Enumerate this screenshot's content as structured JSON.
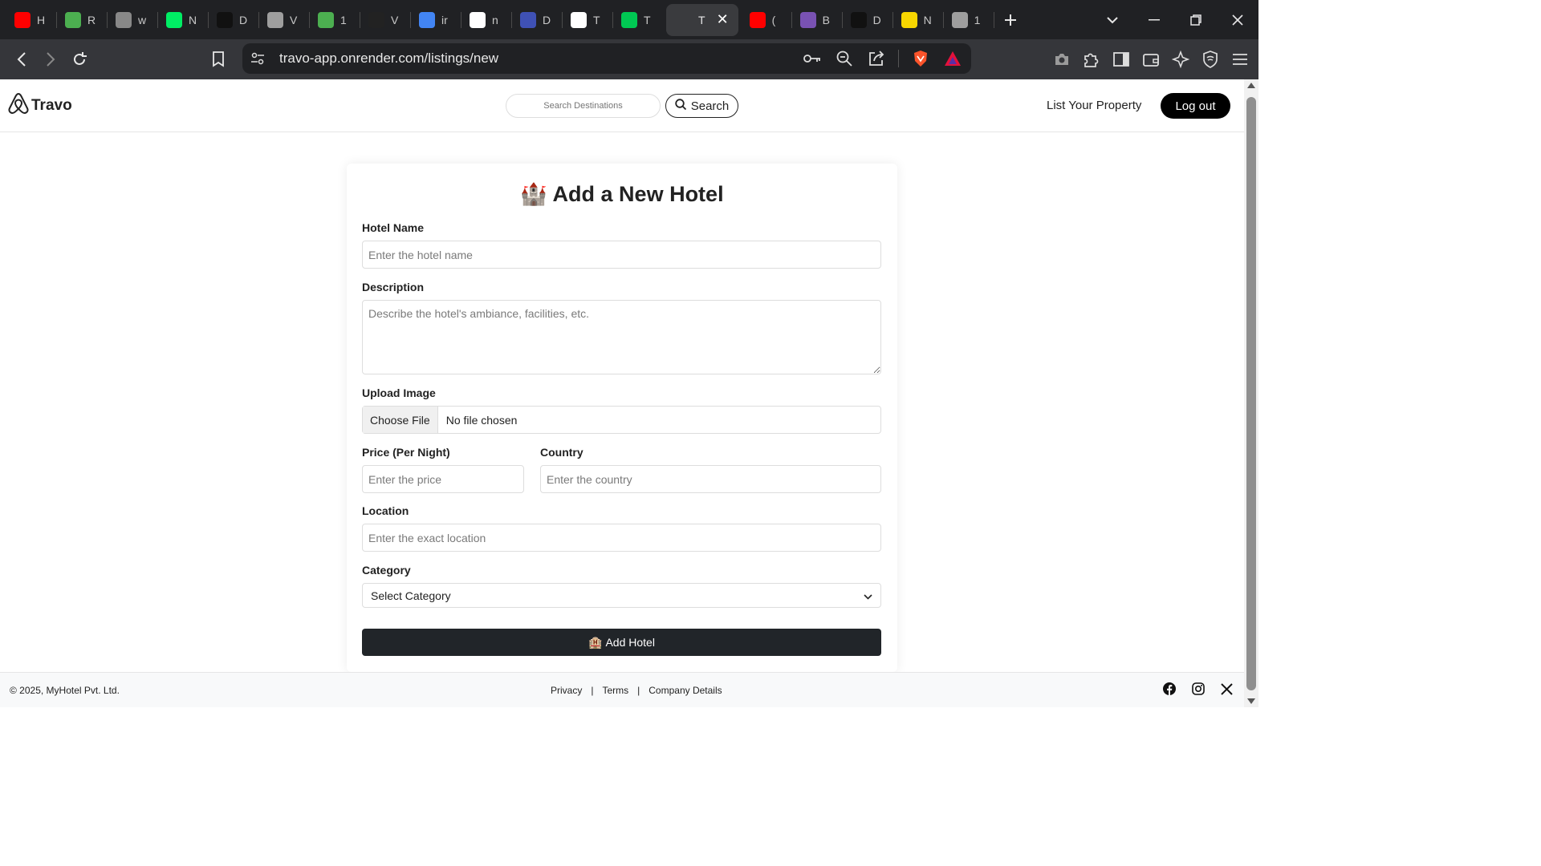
{
  "browser": {
    "tabs": [
      {
        "title": "H",
        "icon": "youtube-icon",
        "color": "#ff0000"
      },
      {
        "title": "R",
        "icon": "leaf-icon",
        "color": "#4caf50"
      },
      {
        "title": "w",
        "icon": "circle-app-icon",
        "color": "#888888"
      },
      {
        "title": "N",
        "icon": "mongodb-leaf-icon",
        "color": "#00ed64"
      },
      {
        "title": "D",
        "icon": "dark-block-icon",
        "color": "#111111"
      },
      {
        "title": "V",
        "icon": "globe-icon",
        "color": "#9e9e9e"
      },
      {
        "title": "1",
        "icon": "px-icon",
        "color": "#4caf50"
      },
      {
        "title": "V",
        "icon": "is-icon",
        "color": "#222222"
      },
      {
        "title": "ir",
        "icon": "google-icon",
        "color": "#4285f4"
      },
      {
        "title": "n",
        "icon": "github-icon",
        "color": "#ffffff"
      },
      {
        "title": "D",
        "icon": "shield-app-icon",
        "color": "#3f51b5"
      },
      {
        "title": "T",
        "icon": "chatgpt-icon",
        "color": "#ffffff"
      },
      {
        "title": "T",
        "icon": "check-app-icon",
        "color": "#00c853"
      },
      {
        "title": "T",
        "icon": "travo-tab-icon",
        "color": "#ffffff",
        "active": true
      },
      {
        "title": "(",
        "icon": "youtube-icon",
        "color": "#ff0000"
      },
      {
        "title": "B",
        "icon": "bootstrap-icon",
        "color": "#7952b3"
      },
      {
        "title": "D",
        "icon": "dark-block-icon",
        "color": "#111111"
      },
      {
        "title": "N",
        "icon": "flipkart-icon",
        "color": "#f7d600"
      },
      {
        "title": "1",
        "icon": "globe-icon",
        "color": "#9e9e9e"
      }
    ],
    "url": "travo-app.onrender.com/listings/new"
  },
  "site": {
    "brand": "Travo",
    "search_placeholder": "Search Destinations",
    "search_label": "Search",
    "list_property": "List Your Property",
    "logout": "Log out"
  },
  "form": {
    "title": "Add a New Hotel",
    "title_emoji": "🏰",
    "hotel_name": {
      "label": "Hotel Name",
      "placeholder": "Enter the hotel name"
    },
    "description": {
      "label": "Description",
      "placeholder": "Describe the hotel's ambiance, facilities, etc."
    },
    "image": {
      "label": "Upload Image",
      "button": "Choose File",
      "status": "No file chosen"
    },
    "price": {
      "label": "Price (Per Night)",
      "placeholder": "Enter the price"
    },
    "country": {
      "label": "Country",
      "placeholder": "Enter the country"
    },
    "location": {
      "label": "Location",
      "placeholder": "Enter the exact location"
    },
    "category": {
      "label": "Category",
      "selected": "Select Category"
    },
    "submit": {
      "emoji": "🏨",
      "label": "Add Hotel"
    }
  },
  "footer": {
    "copyright": "© 2025, MyHotel Pvt. Ltd.",
    "links": [
      "Privacy",
      "Terms",
      "Company Details"
    ],
    "separator": "|",
    "social": [
      "facebook-icon",
      "instagram-icon",
      "x-icon"
    ]
  }
}
